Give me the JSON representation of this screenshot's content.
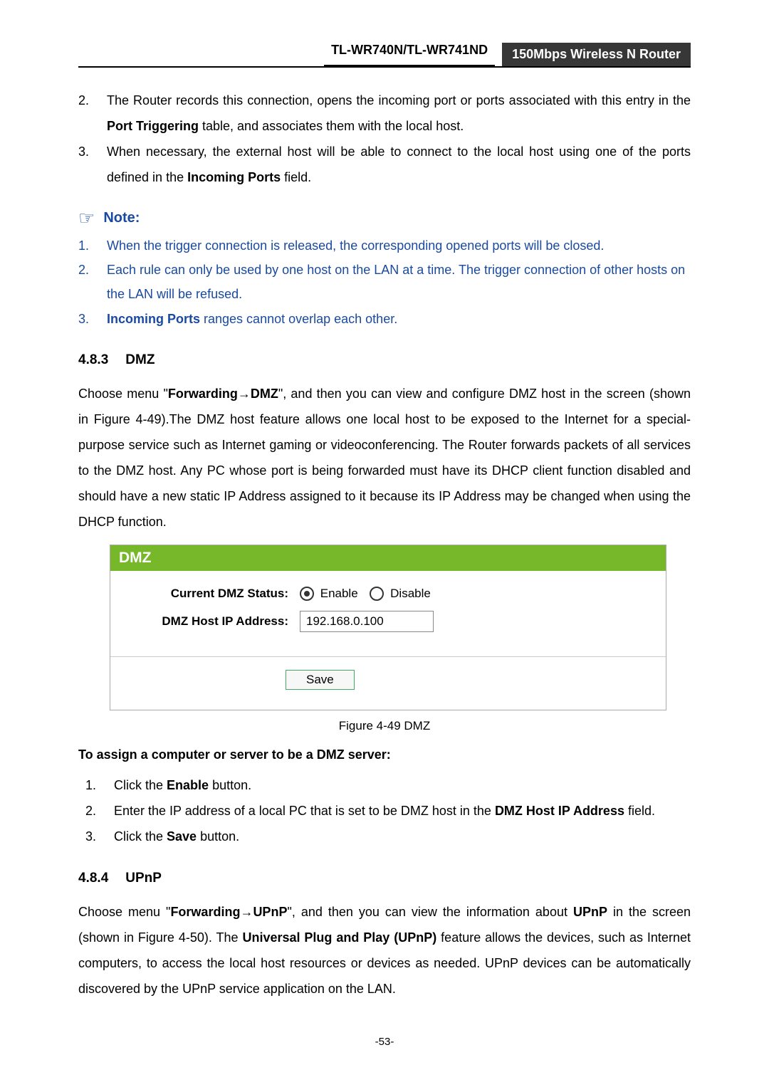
{
  "header": {
    "model": "TL-WR740N/TL-WR741ND",
    "product": "150Mbps Wireless N Router"
  },
  "topList": [
    {
      "num": "2.",
      "text_a": "The Router records this connection, opens the incoming port or ports associated with this entry in the ",
      "bold_a": "Port Triggering",
      "text_b": " table, and associates them with the local host."
    },
    {
      "num": "3.",
      "text_a": "When necessary, the external host will be able to connect to the local host using one of the ports defined in the ",
      "bold_a": "Incoming Ports",
      "text_b": " field."
    }
  ],
  "note": {
    "label": "Note:",
    "items": [
      {
        "num": "1.",
        "text": "When the trigger connection is released, the corresponding opened ports will be closed."
      },
      {
        "num": "2.",
        "text": "Each rule can only be used by one host on the LAN at a time. The trigger connection of other hosts on the LAN will be refused."
      },
      {
        "num": "3.",
        "bold": "Incoming Ports",
        "text": " ranges cannot overlap each other."
      }
    ]
  },
  "section_dmz": {
    "number": "4.8.3",
    "title": "DMZ",
    "para_parts": {
      "a": "Choose menu \"",
      "b": "Forwarding",
      "arrow": "→",
      "c": "DMZ",
      "d": "\", and then you can view and configure DMZ host in the screen (shown in ",
      "fig": "Figure 4-49",
      "e": ").The DMZ host feature allows one local host to be exposed to the Internet for a special-purpose service such as Internet gaming or videoconferencing. The Router forwards packets of all services to the DMZ host. Any PC whose port is being forwarded must have its DHCP client function disabled and should have a new static IP Address assigned to it because its IP Address may be changed when using the DHCP function."
    },
    "shot": {
      "title": "DMZ",
      "status_label": "Current DMZ Status:",
      "enable": "Enable",
      "disable": "Disable",
      "ip_label": "DMZ Host IP Address:",
      "ip_value": "192.168.0.100",
      "save": "Save"
    },
    "caption": "Figure 4-49    DMZ",
    "subhead": "To assign a computer or server to be a DMZ server:",
    "steps": [
      {
        "num": "1.",
        "a": "Click the ",
        "b": "Enable",
        "c": " button."
      },
      {
        "num": "2.",
        "a": "Enter the IP address of a local PC that is set to be DMZ host in the ",
        "b": "DMZ Host IP Address",
        "c": " field."
      },
      {
        "num": "3.",
        "a": "Click the ",
        "b": "Save",
        "c": " button."
      }
    ]
  },
  "section_upnp": {
    "number": "4.8.4",
    "title": "UPnP",
    "p": {
      "a": "Choose menu \"",
      "b": "Forwarding",
      "arrow": "→",
      "c": "UPnP",
      "d": "\", and then you can view the information about ",
      "e": "UPnP",
      "f": " in the screen (shown in ",
      "fig": "Figure 4-50",
      "g": "). The ",
      "h": "Universal Plug and Play (UPnP)",
      "i": " feature allows the devices, such as Internet computers, to access the local host resources or devices as needed. UPnP devices can be automatically discovered by the UPnP service application on the LAN."
    }
  },
  "page_number": "-53-"
}
